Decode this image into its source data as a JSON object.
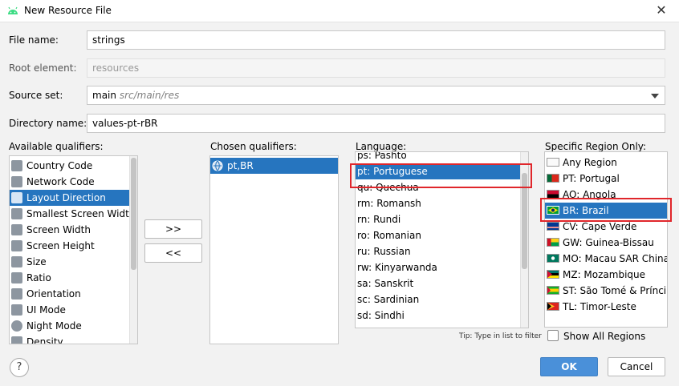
{
  "window": {
    "title": "New Resource File",
    "close_glyph": "✕"
  },
  "form": {
    "file_name": {
      "label": "File name:",
      "value": "strings"
    },
    "root_element": {
      "label": "Root element:",
      "placeholder": "resources"
    },
    "source_set": {
      "label": "Source set:",
      "value": "main",
      "hint": "src/main/res"
    },
    "directory_name": {
      "label": "Directory name:",
      "value": "values-pt-rBR"
    }
  },
  "available_qualifiers": {
    "label": "Available qualifiers:",
    "items": [
      {
        "label": "Country Code",
        "icon": "country-code-icon"
      },
      {
        "label": "Network Code",
        "icon": "network-code-icon"
      },
      {
        "label": "Layout Direction",
        "icon": "layout-direction-icon",
        "selected": true
      },
      {
        "label": "Smallest Screen Width",
        "icon": "smallest-width-icon"
      },
      {
        "label": "Screen Width",
        "icon": "screen-width-icon"
      },
      {
        "label": "Screen Height",
        "icon": "screen-height-icon"
      },
      {
        "label": "Size",
        "icon": "size-icon"
      },
      {
        "label": "Ratio",
        "icon": "ratio-icon"
      },
      {
        "label": "Orientation",
        "icon": "orientation-icon"
      },
      {
        "label": "UI Mode",
        "icon": "ui-mode-icon"
      },
      {
        "label": "Night Mode",
        "icon": "night-mode-icon"
      },
      {
        "label": "Density",
        "icon": "density-icon"
      }
    ]
  },
  "transfer": {
    "add_label": ">>",
    "remove_label": "<<"
  },
  "chosen_qualifiers": {
    "label": "Chosen qualifiers:",
    "items": [
      {
        "label": "pt,BR",
        "icon": "globe-icon",
        "selected": true
      }
    ]
  },
  "language": {
    "label": "Language:",
    "items": [
      {
        "label": "ps: Pashto"
      },
      {
        "label": "pt: Portuguese",
        "selected": true
      },
      {
        "label": "qu: Quechua"
      },
      {
        "label": "rm: Romansh"
      },
      {
        "label": "rn: Rundi"
      },
      {
        "label": "ro: Romanian"
      },
      {
        "label": "ru: Russian"
      },
      {
        "label": "rw: Kinyarwanda"
      },
      {
        "label": "sa: Sanskrit"
      },
      {
        "label": "sc: Sardinian"
      },
      {
        "label": "sd: Sindhi"
      }
    ],
    "tip": "Tip: Type in list to filter"
  },
  "region": {
    "label": "Specific Region Only:",
    "items": [
      {
        "label": "Any Region",
        "flag": "blank"
      },
      {
        "label": "PT: Portugal",
        "flag": "portugal"
      },
      {
        "label": "AO: Angola",
        "flag": "angola"
      },
      {
        "label": "BR: Brazil",
        "flag": "brazil",
        "selected": true
      },
      {
        "label": "CV: Cape Verde",
        "flag": "cape-verde"
      },
      {
        "label": "GW: Guinea-Bissau",
        "flag": "guinea-bissau"
      },
      {
        "label": "MO: Macau SAR China",
        "flag": "macau"
      },
      {
        "label": "MZ: Mozambique",
        "flag": "mozambique"
      },
      {
        "label": "ST: São Tomé & Príncipe",
        "flag": "sao-tome"
      },
      {
        "label": "TL: Timor-Leste",
        "flag": "timor-leste"
      }
    ],
    "show_all": {
      "label": "Show All Regions",
      "checked": false
    }
  },
  "footer": {
    "help_glyph": "?",
    "ok_label": "OK",
    "cancel_label": "Cancel"
  },
  "colors": {
    "selection": "#2675bf",
    "primary_button": "#4a90d9",
    "highlight_box": "#e0262b",
    "android_green": "#3ddc84"
  }
}
